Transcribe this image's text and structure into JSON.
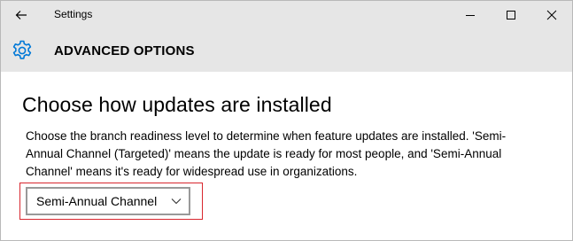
{
  "window": {
    "title": "Settings",
    "controls": {
      "back": "back-arrow-icon",
      "minimize": "minimize-icon",
      "maximize": "maximize-icon",
      "close": "close-icon"
    }
  },
  "header": {
    "icon": "gear-icon",
    "title": "ADVANCED OPTIONS"
  },
  "section": {
    "title": "Choose how updates are installed",
    "description_lines": [
      "Choose the branch readiness level to determine when feature updates are installed. 'Semi-",
      "Annual Channel (Targeted)' means the update is ready for most people, and 'Semi-Annual",
      "Channel' means it's ready for widespread use in organizations."
    ]
  },
  "branch_dropdown": {
    "selected": "Semi-Annual Channel",
    "icon": "chevron-down-icon"
  },
  "colors": {
    "header_bg": "#e6e6e6",
    "accent": "#0078d7",
    "highlight_border": "#d8262e"
  }
}
